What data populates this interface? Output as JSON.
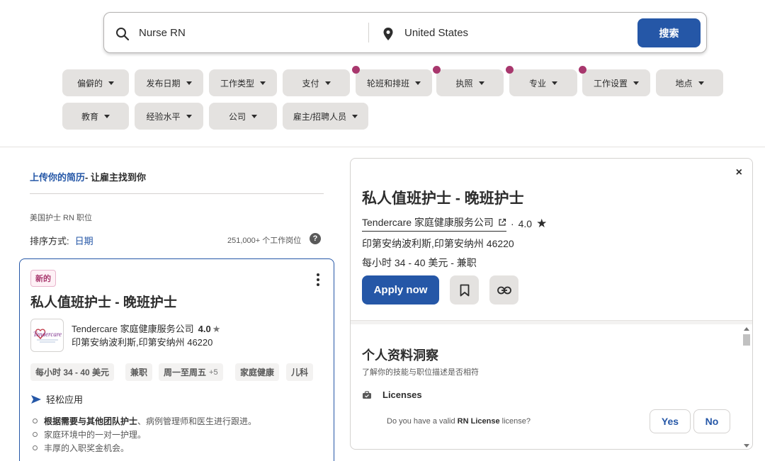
{
  "search": {
    "what_value": "Nurse RN",
    "where_value": "United States",
    "button_label": "搜索"
  },
  "filters": [
    {
      "label": "偏僻的",
      "dot": false
    },
    {
      "label": "发布日期",
      "dot": false
    },
    {
      "label": "工作类型",
      "dot": false
    },
    {
      "label": "支付",
      "dot": false
    },
    {
      "label": "轮班和排班",
      "dot": true
    },
    {
      "label": "执照",
      "dot": true
    },
    {
      "label": "专业",
      "dot": true
    },
    {
      "label": "工作设置",
      "dot": true
    },
    {
      "label": "地点",
      "dot": false
    },
    {
      "label": "教育",
      "dot": false
    },
    {
      "label": "经验水平",
      "dot": false
    },
    {
      "label": "公司",
      "dot": false
    },
    {
      "label": "雇主/招聘人员",
      "dot": false
    }
  ],
  "left": {
    "upload_link": "上传你的简历",
    "upload_rest": "- 让雇主找到你",
    "breadcrumb": "美国护士 RN 职位",
    "sort_label": "排序方式:",
    "sort_value": "日期",
    "job_count": "251,000+ 个工作岗位",
    "help_icon": "?"
  },
  "card": {
    "badge": "新的",
    "title": "私人值班护士 - 晚班护士",
    "logo_text": "Tendercare",
    "company": "Tendercare 家庭健康服务公司",
    "rating": "4.0",
    "rating_star": "★",
    "location": "印第安纳波利斯,印第安纳州 46220",
    "tags": [
      {
        "label": "每小时 34 - 40 美元",
        "more": ""
      },
      {
        "label": "兼职",
        "more": ""
      },
      {
        "label": "周一至周五",
        "more": "+5"
      },
      {
        "label": "家庭健康",
        "more": ""
      },
      {
        "label": "儿科",
        "more": ""
      }
    ],
    "easy_apply": "轻松应用",
    "bullet1_bold": "根据需要与其他团队护士",
    "bullet1_rest": "、病例管理师和医生进行跟进。",
    "bullet2": "家庭环境中的一对一护理。",
    "bullet3": "丰厚的入职奖金机会。"
  },
  "panel": {
    "close": "×",
    "title": "私人值班护士 - 晚班护士",
    "company": "Tendercare 家庭健康服务公司",
    "separator": "·",
    "rating": "4.0",
    "star": "★",
    "location": "印第安纳波利斯,印第安纳州 46220",
    "pay": "每小时 34 - 40 美元 - 兼职",
    "apply_label": "Apply now",
    "insights_title": "个人资料洞察",
    "insights_sub": "了解你的技能与职位描述是否相符",
    "licenses_label": "Licenses",
    "question_pre": "Do you have a valid ",
    "question_bold": "RN License",
    "question_post": " license?",
    "yes_label": "Yes",
    "no_label": "No"
  },
  "colors": {
    "primary": "#2557a7",
    "filter_bg": "#e4e2e0",
    "dot": "#a8376d"
  }
}
